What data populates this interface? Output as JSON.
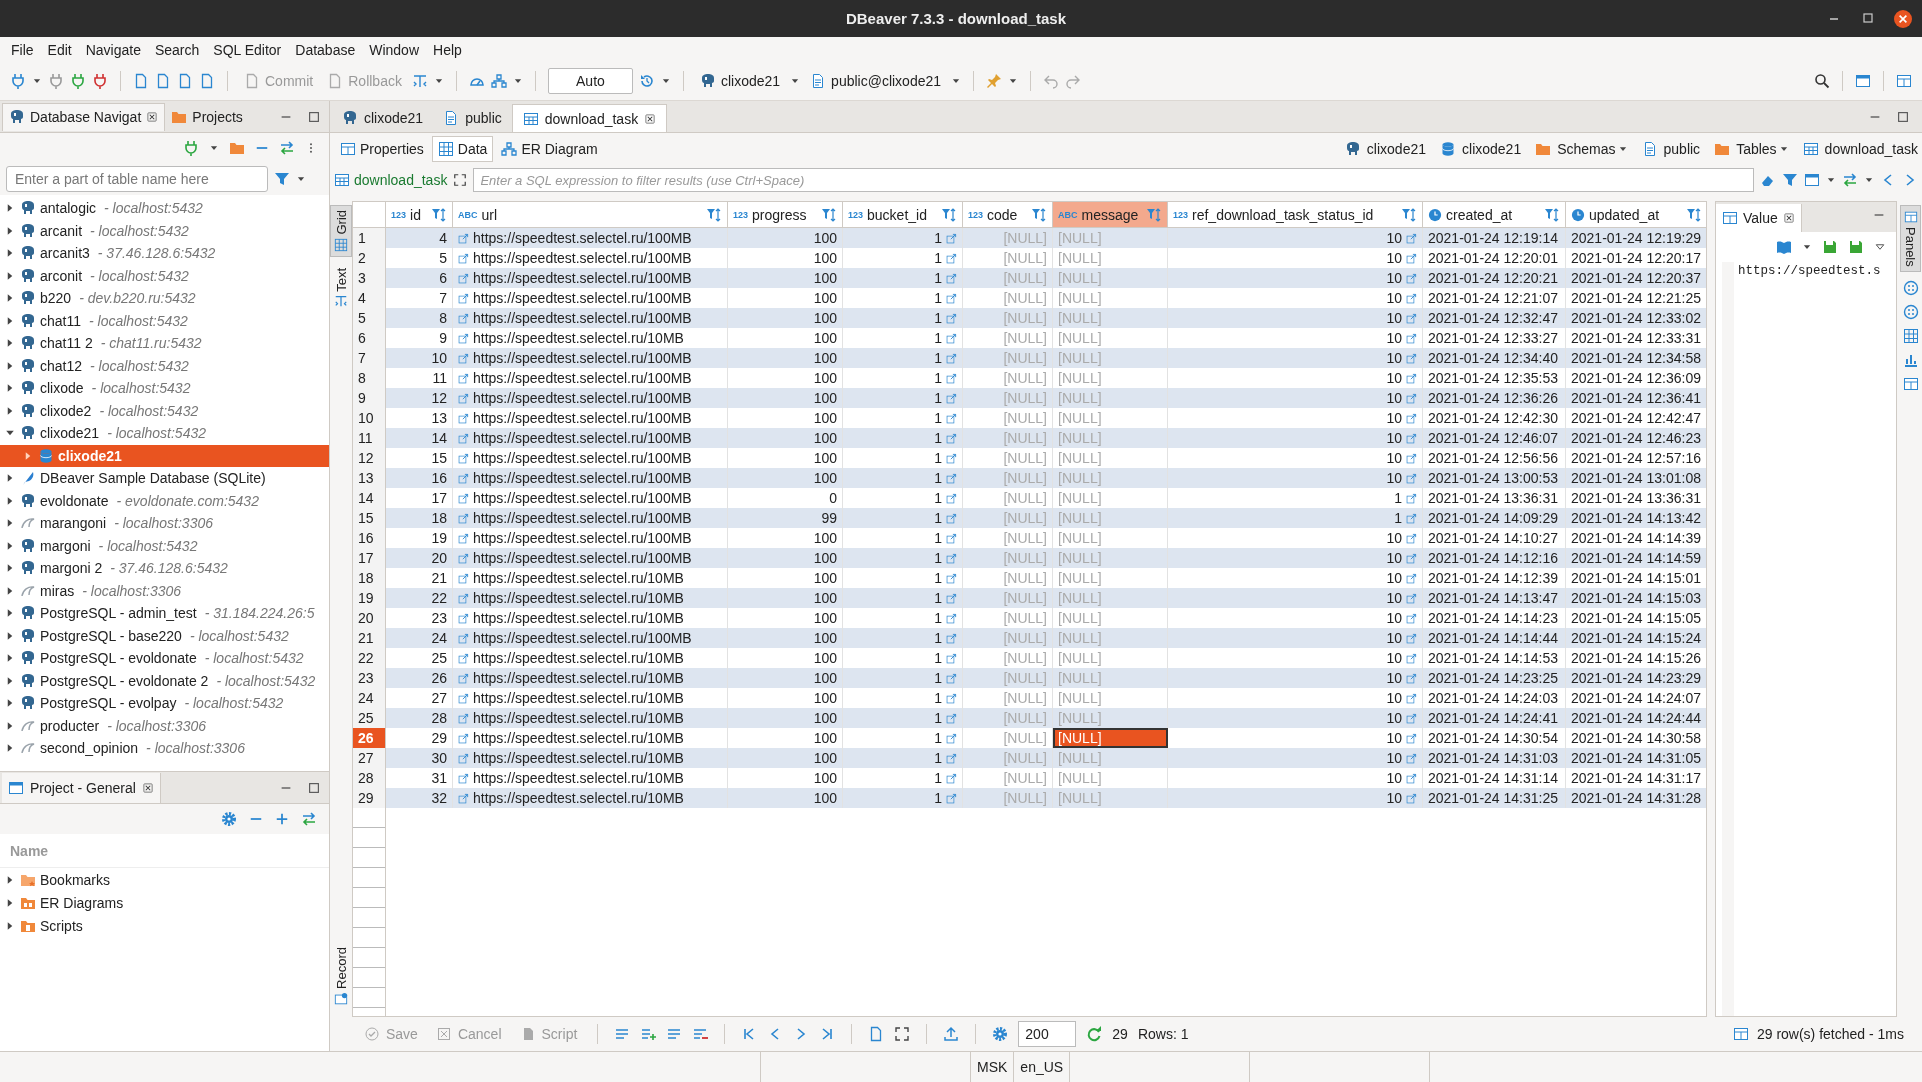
{
  "window": {
    "title": "DBeaver 7.3.3 - download_task"
  },
  "menu": [
    "File",
    "Edit",
    "Navigate",
    "Search",
    "SQL Editor",
    "Database",
    "Window",
    "Help"
  ],
  "toolbar": {
    "commit": {
      "label": "Commit",
      "disabled": true
    },
    "rollback": {
      "label": "Rollback",
      "disabled": true
    },
    "transaction_mode": "Auto",
    "connection": "clixode21",
    "schema": "public@clixode21"
  },
  "navigator": {
    "tabs": [
      {
        "label": "Database Navigat",
        "selected": true
      },
      {
        "label": "Projects",
        "selected": false
      }
    ],
    "filter": {
      "placeholder": "Enter a part of table name here"
    },
    "tree": [
      {
        "name": "antalogic",
        "host": "- localhost:5432",
        "kind": "postgres",
        "expanded": false,
        "selected": false
      },
      {
        "name": "arcanit",
        "host": "- localhost:5432",
        "kind": "postgres",
        "expanded": false,
        "selected": false
      },
      {
        "name": "arcanit3",
        "host": "- 37.46.128.6:5432",
        "kind": "postgres",
        "expanded": false,
        "selected": false
      },
      {
        "name": "arconit",
        "host": "- localhost:5432",
        "kind": "postgres",
        "expanded": false,
        "selected": false
      },
      {
        "name": "b220",
        "host": "- dev.b220.ru:5432",
        "kind": "postgres",
        "expanded": false,
        "selected": false
      },
      {
        "name": "chat11",
        "host": "- localhost:5432",
        "kind": "postgres",
        "expanded": false,
        "selected": false
      },
      {
        "name": "chat11 2",
        "host": "- chat11.ru:5432",
        "kind": "postgres",
        "expanded": false,
        "selected": false
      },
      {
        "name": "chat12",
        "host": "- localhost:5432",
        "kind": "postgres",
        "expanded": false,
        "selected": false
      },
      {
        "name": "clixode",
        "host": "- localhost:5432",
        "kind": "postgres",
        "expanded": false,
        "selected": false
      },
      {
        "name": "clixode2",
        "host": "- localhost:5432",
        "kind": "postgres",
        "expanded": false,
        "selected": false
      },
      {
        "name": "clixode21",
        "host": "- localhost:5432",
        "kind": "postgres",
        "expanded": true,
        "selected": false,
        "children": [
          {
            "name": "clixode21",
            "kind": "database",
            "expanded": false,
            "selected": true
          }
        ]
      },
      {
        "name": "DBeaver Sample Database (SQLite)",
        "kind": "sqlite",
        "expanded": false,
        "selected": false
      },
      {
        "name": "evoldonate",
        "host": "- evoldonate.com:5432",
        "kind": "postgres",
        "expanded": false,
        "selected": false
      },
      {
        "name": "marangoni",
        "host": "- localhost:3306",
        "kind": "mysql",
        "expanded": false,
        "selected": false
      },
      {
        "name": "margoni",
        "host": "- localhost:5432",
        "kind": "postgres",
        "expanded": false,
        "selected": false
      },
      {
        "name": "margoni 2",
        "host": "- 37.46.128.6:5432",
        "kind": "postgres",
        "expanded": false,
        "selected": false
      },
      {
        "name": "miras",
        "host": "- localhost:3306",
        "kind": "mysql",
        "expanded": false,
        "selected": false
      },
      {
        "name": "PostgreSQL - admin_test",
        "host": "- 31.184.224.26:5",
        "kind": "postgres",
        "expanded": false,
        "selected": false
      },
      {
        "name": "PostgreSQL - base220",
        "host": "- localhost:5432",
        "kind": "postgres",
        "expanded": false,
        "selected": false
      },
      {
        "name": "PostgreSQL - evoldonate",
        "host": "- localhost:5432",
        "kind": "postgres",
        "expanded": false,
        "selected": false
      },
      {
        "name": "PostgreSQL - evoldonate 2",
        "host": "- localhost:5432",
        "kind": "postgres",
        "expanded": false,
        "selected": false
      },
      {
        "name": "PostgreSQL - evolpay",
        "host": "- localhost:5432",
        "kind": "postgres",
        "expanded": false,
        "selected": false
      },
      {
        "name": "producter",
        "host": "- localhost:3306",
        "kind": "mysql",
        "expanded": false,
        "selected": false
      },
      {
        "name": "second_opinion",
        "host": "- localhost:3306",
        "kind": "mysql",
        "expanded": false,
        "selected": false
      }
    ]
  },
  "project": {
    "tab": "Project - General",
    "column": "Name",
    "items": [
      {
        "name": "Bookmarks",
        "kind": "bookmarks"
      },
      {
        "name": "ER Diagrams",
        "kind": "diagrams"
      },
      {
        "name": "Scripts",
        "kind": "scripts"
      }
    ]
  },
  "editor": {
    "tabs": [
      {
        "label": "clixode21",
        "kind": "connection",
        "selected": false
      },
      {
        "label": "public",
        "kind": "schema",
        "selected": false
      },
      {
        "label": "download_task",
        "kind": "table",
        "selected": true
      }
    ],
    "subtabs": [
      {
        "label": "Properties",
        "kind": "properties",
        "selected": false
      },
      {
        "label": "Data",
        "kind": "data",
        "selected": true
      },
      {
        "label": "ER Diagram",
        "kind": "diagram",
        "selected": false
      }
    ],
    "breadcrumb": [
      {
        "label": "clixode21",
        "kind": "connection"
      },
      {
        "label": "clixode21",
        "kind": "database"
      },
      {
        "label": "Schemas",
        "kind": "folder"
      },
      {
        "label": "public",
        "kind": "schema"
      },
      {
        "label": "Tables",
        "kind": "folder"
      },
      {
        "label": "download_task",
        "kind": "table"
      }
    ],
    "filter": {
      "table": "download_task",
      "placeholder": "Enter a SQL expression to filter results (use Ctrl+Space)"
    },
    "view_tabs": [
      {
        "label": "Grid",
        "selected": true
      },
      {
        "label": "Text",
        "selected": false
      },
      {
        "label": "Record",
        "selected": false
      }
    ],
    "table": {
      "columns": [
        {
          "name": "id",
          "badge": "123",
          "kind": "number",
          "selected": false
        },
        {
          "name": "url",
          "badge": "ABC",
          "kind": "url",
          "selected": false
        },
        {
          "name": "progress",
          "badge": "123",
          "kind": "number",
          "selected": false
        },
        {
          "name": "bucket_id",
          "badge": "123",
          "kind": "reference",
          "selected": false
        },
        {
          "name": "code",
          "badge": "123",
          "kind": "nullnumber",
          "selected": false
        },
        {
          "name": "message",
          "badge": "ABC",
          "kind": "nulltext",
          "selected": true
        },
        {
          "name": "ref_download_task_status_id",
          "badge": "123",
          "kind": "reference",
          "selected": false
        },
        {
          "name": "created_at",
          "kind": "datetime",
          "selected": false
        },
        {
          "name": "updated_at",
          "kind": "datetime",
          "selected": false
        }
      ],
      "rows": [
        {
          "number": "1",
          "selected": false,
          "cells": [
            "4",
            "https://speedtest.selectel.ru/100MB",
            "100",
            "1",
            "[NULL]",
            "[NULL]",
            "10",
            "2021-01-24 12:19:14",
            "2021-01-24 12:19:29"
          ]
        },
        {
          "number": "2",
          "selected": false,
          "cells": [
            "5",
            "https://speedtest.selectel.ru/100MB",
            "100",
            "1",
            "[NULL]",
            "[NULL]",
            "10",
            "2021-01-24 12:20:01",
            "2021-01-24 12:20:17"
          ]
        },
        {
          "number": "3",
          "selected": false,
          "cells": [
            "6",
            "https://speedtest.selectel.ru/100MB",
            "100",
            "1",
            "[NULL]",
            "[NULL]",
            "10",
            "2021-01-24 12:20:21",
            "2021-01-24 12:20:37"
          ]
        },
        {
          "number": "4",
          "selected": false,
          "cells": [
            "7",
            "https://speedtest.selectel.ru/100MB",
            "100",
            "1",
            "[NULL]",
            "[NULL]",
            "10",
            "2021-01-24 12:21:07",
            "2021-01-24 12:21:25"
          ]
        },
        {
          "number": "5",
          "selected": false,
          "cells": [
            "8",
            "https://speedtest.selectel.ru/100MB",
            "100",
            "1",
            "[NULL]",
            "[NULL]",
            "10",
            "2021-01-24 12:32:47",
            "2021-01-24 12:33:02"
          ]
        },
        {
          "number": "6",
          "selected": false,
          "cells": [
            "9",
            "https://speedtest.selectel.ru/10MB",
            "100",
            "1",
            "[NULL]",
            "[NULL]",
            "10",
            "2021-01-24 12:33:27",
            "2021-01-24 12:33:31"
          ]
        },
        {
          "number": "7",
          "selected": false,
          "cells": [
            "10",
            "https://speedtest.selectel.ru/100MB",
            "100",
            "1",
            "[NULL]",
            "[NULL]",
            "10",
            "2021-01-24 12:34:40",
            "2021-01-24 12:34:58"
          ]
        },
        {
          "number": "8",
          "selected": false,
          "cells": [
            "11",
            "https://speedtest.selectel.ru/100MB",
            "100",
            "1",
            "[NULL]",
            "[NULL]",
            "10",
            "2021-01-24 12:35:53",
            "2021-01-24 12:36:09"
          ]
        },
        {
          "number": "9",
          "selected": false,
          "cells": [
            "12",
            "https://speedtest.selectel.ru/100MB",
            "100",
            "1",
            "[NULL]",
            "[NULL]",
            "10",
            "2021-01-24 12:36:26",
            "2021-01-24 12:36:41"
          ]
        },
        {
          "number": "10",
          "selected": false,
          "cells": [
            "13",
            "https://speedtest.selectel.ru/100MB",
            "100",
            "1",
            "[NULL]",
            "[NULL]",
            "10",
            "2021-01-24 12:42:30",
            "2021-01-24 12:42:47"
          ]
        },
        {
          "number": "11",
          "selected": false,
          "cells": [
            "14",
            "https://speedtest.selectel.ru/100MB",
            "100",
            "1",
            "[NULL]",
            "[NULL]",
            "10",
            "2021-01-24 12:46:07",
            "2021-01-24 12:46:23"
          ]
        },
        {
          "number": "12",
          "selected": false,
          "cells": [
            "15",
            "https://speedtest.selectel.ru/100MB",
            "100",
            "1",
            "[NULL]",
            "[NULL]",
            "10",
            "2021-01-24 12:56:56",
            "2021-01-24 12:57:16"
          ]
        },
        {
          "number": "13",
          "selected": false,
          "cells": [
            "16",
            "https://speedtest.selectel.ru/100MB",
            "100",
            "1",
            "[NULL]",
            "[NULL]",
            "10",
            "2021-01-24 13:00:53",
            "2021-01-24 13:01:08"
          ]
        },
        {
          "number": "14",
          "selected": false,
          "cells": [
            "17",
            "https://speedtest.selectel.ru/100MB",
            "0",
            "1",
            "[NULL]",
            "[NULL]",
            "1",
            "2021-01-24 13:36:31",
            "2021-01-24 13:36:31"
          ]
        },
        {
          "number": "15",
          "selected": false,
          "cells": [
            "18",
            "https://speedtest.selectel.ru/100MB",
            "99",
            "1",
            "[NULL]",
            "[NULL]",
            "1",
            "2021-01-24 14:09:29",
            "2021-01-24 14:13:42"
          ]
        },
        {
          "number": "16",
          "selected": false,
          "cells": [
            "19",
            "https://speedtest.selectel.ru/100MB",
            "100",
            "1",
            "[NULL]",
            "[NULL]",
            "10",
            "2021-01-24 14:10:27",
            "2021-01-24 14:14:39"
          ]
        },
        {
          "number": "17",
          "selected": false,
          "cells": [
            "20",
            "https://speedtest.selectel.ru/100MB",
            "100",
            "1",
            "[NULL]",
            "[NULL]",
            "10",
            "2021-01-24 14:12:16",
            "2021-01-24 14:14:59"
          ]
        },
        {
          "number": "18",
          "selected": false,
          "cells": [
            "21",
            "https://speedtest.selectel.ru/10MB",
            "100",
            "1",
            "[NULL]",
            "[NULL]",
            "10",
            "2021-01-24 14:12:39",
            "2021-01-24 14:15:01"
          ]
        },
        {
          "number": "19",
          "selected": false,
          "cells": [
            "22",
            "https://speedtest.selectel.ru/10MB",
            "100",
            "1",
            "[NULL]",
            "[NULL]",
            "10",
            "2021-01-24 14:13:47",
            "2021-01-24 14:15:03"
          ]
        },
        {
          "number": "20",
          "selected": false,
          "cells": [
            "23",
            "https://speedtest.selectel.ru/10MB",
            "100",
            "1",
            "[NULL]",
            "[NULL]",
            "10",
            "2021-01-24 14:14:23",
            "2021-01-24 14:15:05"
          ]
        },
        {
          "number": "21",
          "selected": false,
          "cells": [
            "24",
            "https://speedtest.selectel.ru/100MB",
            "100",
            "1",
            "[NULL]",
            "[NULL]",
            "10",
            "2021-01-24 14:14:44",
            "2021-01-24 14:15:24"
          ]
        },
        {
          "number": "22",
          "selected": false,
          "cells": [
            "25",
            "https://speedtest.selectel.ru/10MB",
            "100",
            "1",
            "[NULL]",
            "[NULL]",
            "10",
            "2021-01-24 14:14:53",
            "2021-01-24 14:15:26"
          ]
        },
        {
          "number": "23",
          "selected": false,
          "cells": [
            "26",
            "https://speedtest.selectel.ru/10MB",
            "100",
            "1",
            "[NULL]",
            "[NULL]",
            "10",
            "2021-01-24 14:23:25",
            "2021-01-24 14:23:29"
          ]
        },
        {
          "number": "24",
          "selected": false,
          "cells": [
            "27",
            "https://speedtest.selectel.ru/10MB",
            "100",
            "1",
            "[NULL]",
            "[NULL]",
            "10",
            "2021-01-24 14:24:03",
            "2021-01-24 14:24:07"
          ]
        },
        {
          "number": "25",
          "selected": false,
          "cells": [
            "28",
            "https://speedtest.selectel.ru/10MB",
            "100",
            "1",
            "[NULL]",
            "[NULL]",
            "10",
            "2021-01-24 14:24:41",
            "2021-01-24 14:24:44"
          ]
        },
        {
          "number": "26",
          "selected": true,
          "cells": [
            "29",
            "https://speedtest.selectel.ru/10MB",
            "100",
            "1",
            "[NULL]",
            "[NULL]",
            "10",
            "2021-01-24 14:30:54",
            "2021-01-24 14:30:58"
          ]
        },
        {
          "number": "27",
          "selected": false,
          "cells": [
            "30",
            "https://speedtest.selectel.ru/10MB",
            "100",
            "1",
            "[NULL]",
            "[NULL]",
            "10",
            "2021-01-24 14:31:03",
            "2021-01-24 14:31:05"
          ]
        },
        {
          "number": "28",
          "selected": false,
          "cells": [
            "31",
            "https://speedtest.selectel.ru/10MB",
            "100",
            "1",
            "[NULL]",
            "[NULL]",
            "10",
            "2021-01-24 14:31:14",
            "2021-01-24 14:31:17"
          ]
        },
        {
          "number": "29",
          "selected": false,
          "cells": [
            "32",
            "https://speedtest.selectel.ru/10MB",
            "100",
            "1",
            "[NULL]",
            "[NULL]",
            "10",
            "2021-01-24 14:31:25",
            "2021-01-24 14:31:28"
          ]
        }
      ]
    },
    "value_panel": {
      "tab": "Value",
      "content": "https://speedtest.s"
    },
    "panels_tab": {
      "label": "Panels",
      "selected": true
    }
  },
  "results_toolbar": {
    "save": {
      "label": "Save",
      "disabled": true
    },
    "cancel": {
      "label": "Cancel",
      "disabled": true
    },
    "script": {
      "label": "Script",
      "disabled": true
    },
    "fetch_size": "200",
    "count": "29",
    "rows": "Rows: 1",
    "fetched": "29 row(s) fetched - 1ms"
  },
  "status_bar": [
    "MSK",
    "en_US"
  ]
}
